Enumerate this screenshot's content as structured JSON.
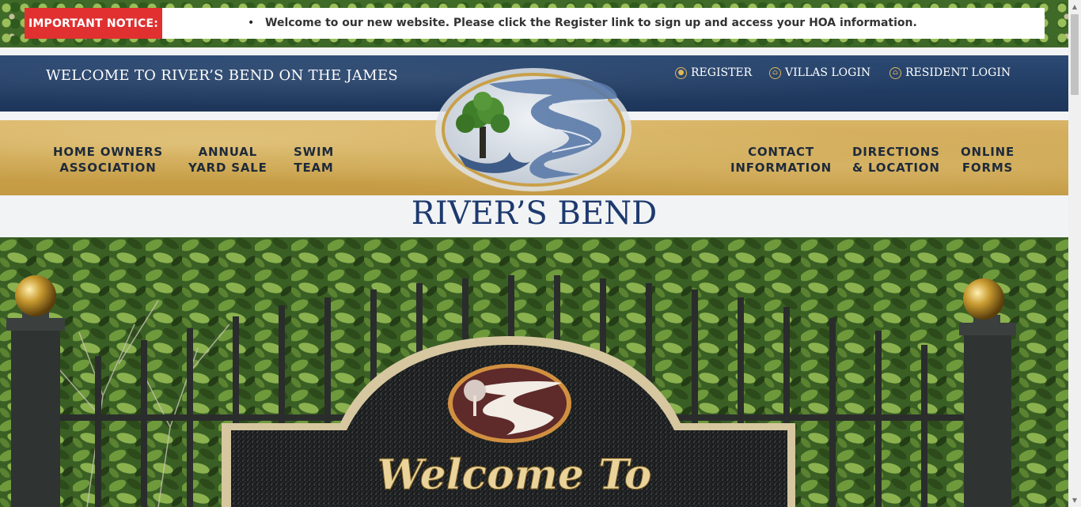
{
  "notice": {
    "label": "IMPORTANT NOTICE:",
    "message": "Welcome to our new website. Please click the Register link to sign up and access your HOA information."
  },
  "header": {
    "welcome": "WELCOME TO RIVER’S BEND ON THE JAMES",
    "links": [
      {
        "label": "REGISTER",
        "icon": "user-circle-icon"
      },
      {
        "label": "VILLAS LOGIN",
        "icon": "home-circle-icon"
      },
      {
        "label": "RESIDENT LOGIN",
        "icon": "home-circle-icon"
      }
    ]
  },
  "nav": {
    "left": [
      {
        "line1": "HOME OWNERS",
        "line2": "ASSOCIATION"
      },
      {
        "line1": "ANNUAL",
        "line2": "YARD SALE"
      },
      {
        "line1": "SWIM",
        "line2": "TEAM"
      }
    ],
    "right": [
      {
        "line1": "CONTACT",
        "line2": "INFORMATION"
      },
      {
        "line1": "DIRECTIONS",
        "line2": "& LOCATION"
      },
      {
        "line1": "ONLINE",
        "line2": "FORMS"
      }
    ]
  },
  "logo": {
    "wordmark": "RIVER’S BEND"
  },
  "hero": {
    "sign_text": "Welcome To"
  },
  "colors": {
    "notice_red": "#e03030",
    "navy": "#213c63",
    "gold": "#c9a048",
    "logo_blue": "#1d3a6e"
  }
}
